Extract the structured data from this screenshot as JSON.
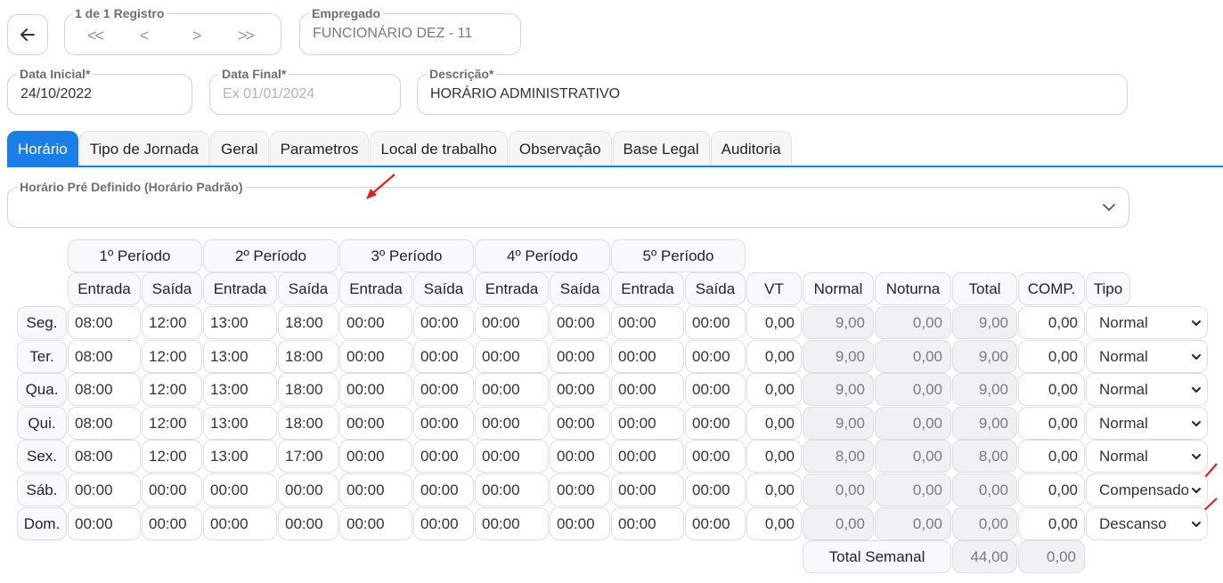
{
  "header": {
    "back_icon": "arrow-left-icon",
    "navigator": {
      "label": "1 de 1 Registro",
      "first": "<<",
      "prev": "<",
      "next": ">",
      "last": ">>"
    },
    "employee": {
      "label": "Empregado",
      "value": "FUNCIONÁRIO DEZ - 11"
    }
  },
  "form": {
    "start_date": {
      "label": "Data Inicial*",
      "value": "24/10/2022"
    },
    "end_date": {
      "label": "Data Final*",
      "value": "",
      "placeholder": "Ex 01/01/2024"
    },
    "description": {
      "label": "Descrição*",
      "value": "HORÁRIO ADMINISTRATIVO"
    }
  },
  "tabs": [
    {
      "label": "Horário",
      "active": true
    },
    {
      "label": "Tipo de Jornada",
      "active": false
    },
    {
      "label": "Geral",
      "active": false
    },
    {
      "label": "Parametros",
      "active": false
    },
    {
      "label": "Local de trabalho",
      "active": false
    },
    {
      "label": "Observação",
      "active": false
    },
    {
      "label": "Base Legal",
      "active": false
    },
    {
      "label": "Auditoria",
      "active": false
    }
  ],
  "predefined_schedule": {
    "label": "Horário Pré Definido (Horário Padrão)",
    "value": ""
  },
  "schedule": {
    "period_headers": [
      "1º Período",
      "2º Período",
      "3º Período",
      "4º Período",
      "5º Período"
    ],
    "column_headers": [
      "Entrada",
      "Saída",
      "Entrada",
      "Saída",
      "Entrada",
      "Saída",
      "Entrada",
      "Saída",
      "Entrada",
      "Saída",
      "VT",
      "Normal",
      "Noturna",
      "Total",
      "COMP.",
      "Tipo"
    ],
    "rows": [
      {
        "day": "Seg.",
        "times": [
          "08:00",
          "12:00",
          "13:00",
          "18:00",
          "00:00",
          "00:00",
          "00:00",
          "00:00",
          "00:00",
          "00:00"
        ],
        "vt": "0,00",
        "normal": "9,00",
        "noturna": "0,00",
        "total": "9,00",
        "comp": "0,00",
        "tipo": "Normal"
      },
      {
        "day": "Ter.",
        "times": [
          "08:00",
          "12:00",
          "13:00",
          "18:00",
          "00:00",
          "00:00",
          "00:00",
          "00:00",
          "00:00",
          "00:00"
        ],
        "vt": "0,00",
        "normal": "9,00",
        "noturna": "0,00",
        "total": "9,00",
        "comp": "0,00",
        "tipo": "Normal"
      },
      {
        "day": "Qua.",
        "times": [
          "08:00",
          "12:00",
          "13:00",
          "18:00",
          "00:00",
          "00:00",
          "00:00",
          "00:00",
          "00:00",
          "00:00"
        ],
        "vt": "0,00",
        "normal": "9,00",
        "noturna": "0,00",
        "total": "9,00",
        "comp": "0,00",
        "tipo": "Normal"
      },
      {
        "day": "Qui.",
        "times": [
          "08:00",
          "12:00",
          "13:00",
          "18:00",
          "00:00",
          "00:00",
          "00:00",
          "00:00",
          "00:00",
          "00:00"
        ],
        "vt": "0,00",
        "normal": "9,00",
        "noturna": "0,00",
        "total": "9,00",
        "comp": "0,00",
        "tipo": "Normal"
      },
      {
        "day": "Sex.",
        "times": [
          "08:00",
          "12:00",
          "13:00",
          "17:00",
          "00:00",
          "00:00",
          "00:00",
          "00:00",
          "00:00",
          "00:00"
        ],
        "vt": "0,00",
        "normal": "8,00",
        "noturna": "0,00",
        "total": "8,00",
        "comp": "0,00",
        "tipo": "Normal"
      },
      {
        "day": "Sáb.",
        "times": [
          "00:00",
          "00:00",
          "00:00",
          "00:00",
          "00:00",
          "00:00",
          "00:00",
          "00:00",
          "00:00",
          "00:00"
        ],
        "vt": "0,00",
        "normal": "0,00",
        "noturna": "0,00",
        "total": "0,00",
        "comp": "0,00",
        "tipo": "Compensado"
      },
      {
        "day": "Dom.",
        "times": [
          "00:00",
          "00:00",
          "00:00",
          "00:00",
          "00:00",
          "00:00",
          "00:00",
          "00:00",
          "00:00",
          "00:00"
        ],
        "vt": "0,00",
        "normal": "0,00",
        "noturna": "0,00",
        "total": "0,00",
        "comp": "0,00",
        "tipo": "Descanso"
      }
    ],
    "weekly_total": {
      "label": "Total Semanal",
      "total": "44,00",
      "comp": "0,00"
    }
  },
  "annotations": {
    "arrow_color": "#e02020",
    "accent_color": "#1b7de8"
  }
}
